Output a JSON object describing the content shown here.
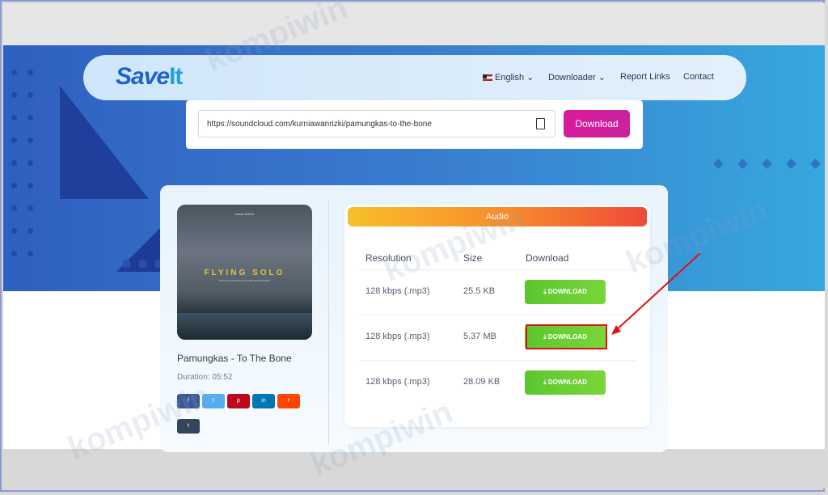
{
  "navbar": {
    "logo_main": "Save",
    "logo_accent": "It",
    "language": "English",
    "downloader": "Downloader",
    "report": "Report Links",
    "contact": "Contact"
  },
  "search": {
    "url_value": "https://soundcloud.com/kurniawanrizki/pamungkas-to-the-bone",
    "button_label": "Download"
  },
  "track": {
    "cover_brand": "mawa ANIKA",
    "cover_title": "FLYING SOLO",
    "cover_subtitle": "ORIGINAL MOTION PICTURE SOUNDTRACK",
    "title": "Pamungkas - To The Bone",
    "duration": "Duration: 05:52"
  },
  "share": {
    "facebook": "f",
    "twitter": "t",
    "pinterest": "p",
    "linkedin": "in",
    "reddit": "r",
    "tumblr": "t"
  },
  "audio": {
    "header": "Audio",
    "col_resolution": "Resolution",
    "col_size": "Size",
    "col_download": "Download",
    "rows": [
      {
        "resolution": "128 kbps (.mp3)",
        "size": "25.5 KB",
        "button": "⤓ DOWNLOAD"
      },
      {
        "resolution": "128 kbps (.mp3)",
        "size": "5.37 MB",
        "button": "⤓ DOWNLOAD"
      },
      {
        "resolution": "128 kbps (.mp3)",
        "size": "28.09 KB",
        "button": "⤓ DOWNLOAD"
      }
    ]
  },
  "watermark": "kompiwin"
}
